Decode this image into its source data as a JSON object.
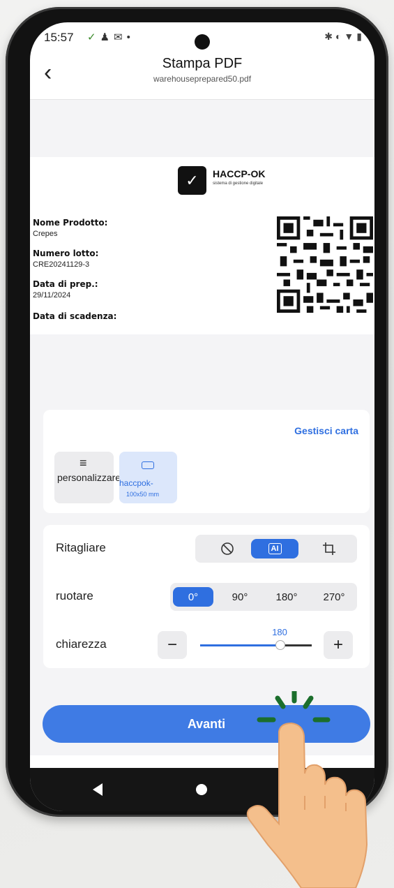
{
  "status_bar": {
    "time": "15:57",
    "left_icons": [
      "haccp-logo-icon",
      "person-icon",
      "gmail-icon",
      "dot-icon"
    ],
    "right_icons": [
      "bluetooth-icon",
      "vibrate-icon",
      "wifi-icon",
      "battery-icon"
    ]
  },
  "header": {
    "title": "Stampa PDF",
    "subtitle": "warehouseprepared50.pdf",
    "back_icon": "chevron-left-icon"
  },
  "label_preview": {
    "brand_name": "HACCP-OK",
    "brand_tagline": "sistema di gestione digitale",
    "fields": [
      {
        "label": "Nome Prodotto:",
        "value": "Crepes"
      },
      {
        "label": "Numero lotto:",
        "value": "CRE20241129-3"
      },
      {
        "label": "Data di prep.:",
        "value": "29/11/2024"
      },
      {
        "label": "Data di scadenza:",
        "value": ""
      }
    ]
  },
  "paper": {
    "manage_link": "Gestisci carta",
    "options": [
      {
        "label": "personalizzare",
        "icon": "edit-lines-icon"
      },
      {
        "label": "haccpok-",
        "size": "100x50 mm",
        "icon": "rectangle-icon",
        "selected": true
      }
    ]
  },
  "settings": {
    "crop": {
      "label": "Ritagliare",
      "options": [
        "none-icon",
        "ai-crop-icon",
        "crop-icon"
      ],
      "selected_index": 1,
      "ai_text": "AI"
    },
    "rotate": {
      "label": "ruotare",
      "options": [
        "0°",
        "90°",
        "180°",
        "270°"
      ],
      "selected_index": 0
    },
    "brightness": {
      "label": "chiarezza",
      "value": "180",
      "fraction": 0.72,
      "minus": "−",
      "plus": "+"
    }
  },
  "primary_button": {
    "label": "Avanti"
  },
  "colors": {
    "accent": "#2f6fe0",
    "button": "#3f7be4",
    "tap_highlight": "#1b6e2c",
    "hand": "#f4bf8c"
  }
}
